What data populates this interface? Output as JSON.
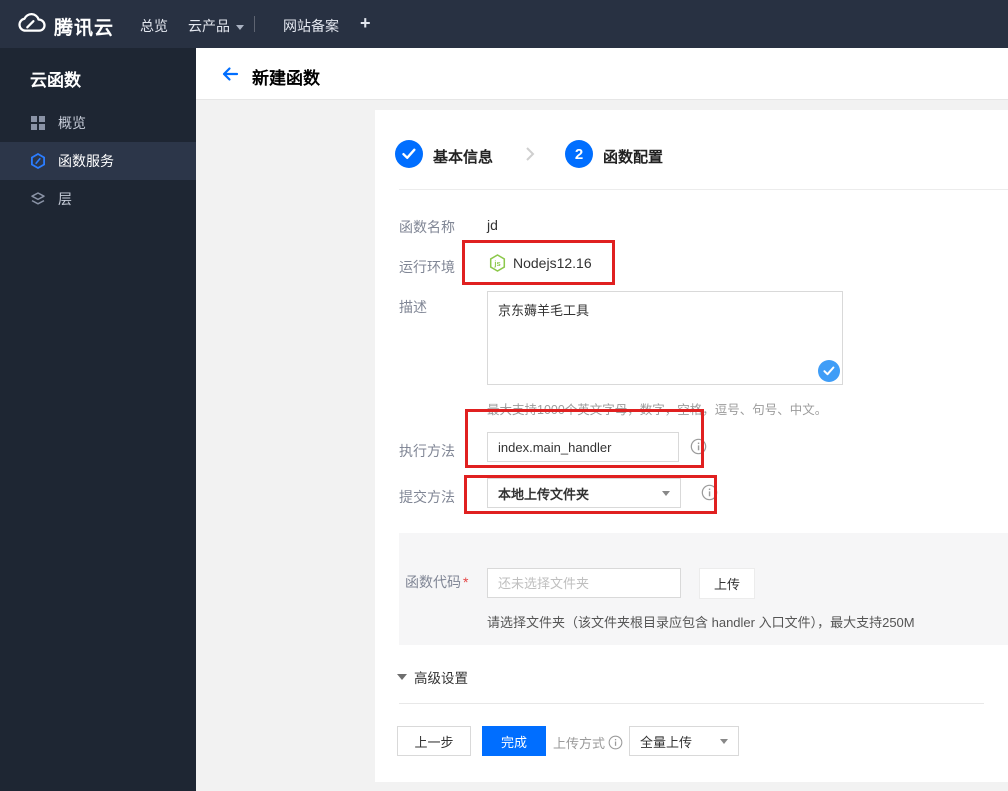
{
  "topbar": {
    "brand": "腾讯云",
    "nav_overview": "总览",
    "nav_products": "云产品",
    "nav_icp": "网站备案",
    "nav_add": "+"
  },
  "sidebar": {
    "title": "云函数",
    "items": [
      {
        "label": "概览",
        "icon": "grid-icon",
        "active": false
      },
      {
        "label": "函数服务",
        "icon": "function-hexagon-icon",
        "active": true
      },
      {
        "label": "层",
        "icon": "layers-icon",
        "active": false
      }
    ]
  },
  "header": {
    "title": "新建函数"
  },
  "stepper": {
    "step1_label": "基本信息",
    "step2_number": "2",
    "step2_label": "函数配置"
  },
  "form": {
    "name_label": "函数名称",
    "name_value": "jd",
    "runtime_label": "运行环境",
    "runtime_value": "Nodejs12.16",
    "runtime_icon_text": "js",
    "desc_label": "描述",
    "desc_value": "京东薅羊毛工具",
    "desc_hint": "最大支持1000个英文字母，数字，空格，逗号、句号、中文。",
    "handler_label": "执行方法",
    "handler_value": "index.main_handler",
    "submit_label": "提交方法",
    "submit_value": "本地上传文件夹",
    "code_label": "函数代码",
    "required_mark": "*",
    "code_placeholder": "还未选择文件夹",
    "upload_button": "上传",
    "code_hint": "请选择文件夹（该文件夹根目录应包含 handler 入口文件），最大支持250M",
    "advanced_label": "高级设置"
  },
  "footer": {
    "prev_button": "上一步",
    "finish_button": "完成",
    "upload_mode_label": "上传方式",
    "upload_mode_value": "全量上传"
  },
  "colors": {
    "primary_blue": "#006eff",
    "annotation_red": "#e02020",
    "nodejs_green": "#8cc84b",
    "valid_check_blue": "#3f9df7",
    "topbar_bg": "#283142",
    "sidebar_bg": "#1e2633",
    "sidebar_active_bg": "#2c3649",
    "content_bg": "#f2f2f2",
    "panel_bg": "#f6f6f7"
  }
}
